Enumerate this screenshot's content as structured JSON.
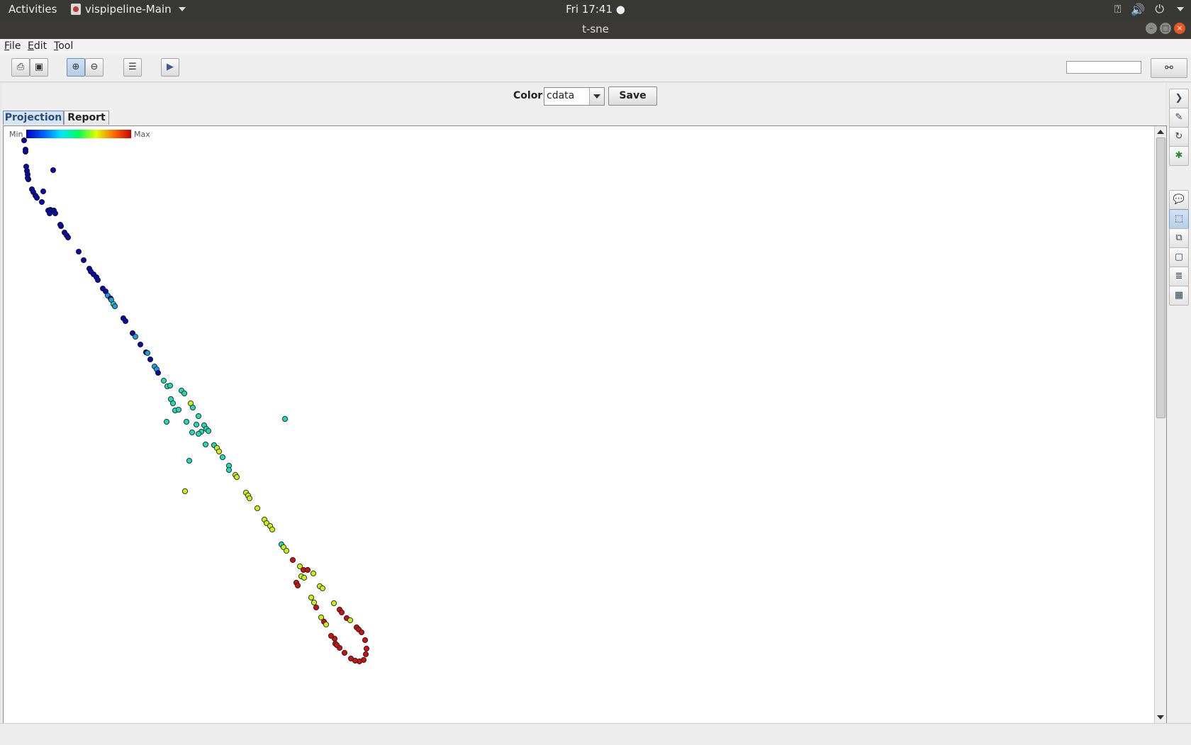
{
  "topbar": {
    "activities": "Activities",
    "app_menu": "vispipeline-Main",
    "clock": "Fri 17:41 ●",
    "tray_icons": [
      "network-icon",
      "volume-icon",
      "power-icon"
    ]
  },
  "window": {
    "title": "t-sne",
    "controls": [
      "minimize-icon",
      "maximize-icon",
      "close-icon"
    ]
  },
  "menubar": {
    "file": "File",
    "edit": "Edit",
    "tool": "Tool"
  },
  "toolbar": {
    "buttons": [
      "open-icon",
      "save-icon",
      "zoom-in-icon",
      "zoom-out-icon",
      "list-icon",
      "play-icon"
    ],
    "search_value": "",
    "find_button_icon": "binoculars-icon"
  },
  "projection": {
    "color_label": "Color",
    "color_value": "cdata",
    "save_label": "Save",
    "tabs": [
      "Projection",
      "Report"
    ],
    "selected_tab": "Projection",
    "legend_min": "Min",
    "legend_max": "Max",
    "colormap": [
      "#0000bb",
      "#0060ff",
      "#00e5ff",
      "#00ff55",
      "#dfff00",
      "#ff6a00",
      "#cc0000"
    ]
  },
  "sidebar": {
    "buttons": [
      "expand-icon",
      "edit-icon",
      "refresh-icon",
      "star-icon",
      "comment-icon",
      "select-icon",
      "copy-icon",
      "frame-icon",
      "list-icon",
      "table-icon"
    ]
  },
  "chart_data": {
    "type": "scatter",
    "title": "",
    "xlabel": "",
    "ylabel": "",
    "color_scale": "Min-Max jet colormap (cdata)",
    "x_range": [
      0,
      1640
    ],
    "y_range": [
      0,
      842
    ],
    "note_units": "coordinates are projection-space positions in plot pixels (no axes printed)",
    "points": [
      [
        33,
        197,
        0
      ],
      [
        35,
        210,
        0
      ],
      [
        35,
        213,
        0
      ],
      [
        36,
        234,
        0
      ],
      [
        37,
        240,
        0
      ],
      [
        38,
        245,
        0
      ],
      [
        39,
        252,
        0
      ],
      [
        38,
        250,
        0
      ],
      [
        74,
        239,
        0
      ],
      [
        44,
        266,
        0
      ],
      [
        46,
        270,
        0
      ],
      [
        49,
        275,
        0
      ],
      [
        51,
        278,
        0
      ],
      [
        60,
        269,
        0
      ],
      [
        58,
        284,
        0
      ],
      [
        67,
        296,
        0
      ],
      [
        70,
        295,
        0
      ],
      [
        75,
        296,
        0
      ],
      [
        77,
        300,
        0
      ],
      [
        69,
        300,
        0
      ],
      [
        85,
        318,
        0
      ],
      [
        84,
        316,
        0
      ],
      [
        90,
        327,
        0
      ],
      [
        93,
        331,
        0
      ],
      [
        95,
        334,
        0
      ],
      [
        110,
        354,
        0
      ],
      [
        117,
        366,
        0
      ],
      [
        125,
        378,
        0
      ],
      [
        127,
        382,
        0
      ],
      [
        131,
        386,
        0
      ],
      [
        135,
        390,
        0
      ],
      [
        137,
        394,
        0
      ],
      [
        144,
        406,
        0
      ],
      [
        148,
        410,
        0
      ],
      [
        151,
        416,
        1
      ],
      [
        155,
        420,
        0
      ],
      [
        156,
        422,
        1
      ],
      [
        159,
        428,
        2
      ],
      [
        161,
        431,
        1
      ],
      [
        173,
        448,
        0
      ],
      [
        176,
        452,
        0
      ],
      [
        186,
        469,
        0
      ],
      [
        190,
        474,
        1
      ],
      [
        197,
        485,
        0
      ],
      [
        205,
        496,
        0
      ],
      [
        207,
        497,
        1
      ],
      [
        211,
        506,
        0
      ],
      [
        217,
        516,
        1
      ],
      [
        220,
        520,
        1
      ],
      [
        222,
        525,
        0
      ],
      [
        230,
        536,
        2
      ],
      [
        235,
        544,
        2
      ],
      [
        239,
        543,
        2
      ],
      [
        255,
        550,
        2
      ],
      [
        259,
        554,
        2
      ],
      [
        240,
        562,
        2
      ],
      [
        243,
        568,
        2
      ],
      [
        268,
        568,
        3
      ],
      [
        271,
        574,
        2
      ],
      [
        246,
        578,
        2
      ],
      [
        251,
        577,
        2
      ],
      [
        279,
        586,
        2
      ],
      [
        234,
        594,
        2
      ],
      [
        262,
        594,
        2
      ],
      [
        276,
        598,
        2
      ],
      [
        287,
        599,
        2
      ],
      [
        290,
        604,
        2
      ],
      [
        283,
        608,
        2
      ],
      [
        270,
        609,
        2
      ],
      [
        293,
        607,
        2
      ],
      [
        279,
        611,
        2
      ],
      [
        401,
        590,
        2
      ],
      [
        289,
        626,
        2
      ],
      [
        301,
        627,
        2
      ],
      [
        305,
        631,
        3
      ],
      [
        308,
        636,
        3
      ],
      [
        313,
        644,
        2
      ],
      [
        266,
        649,
        2
      ],
      [
        322,
        656,
        2
      ],
      [
        322,
        662,
        2
      ],
      [
        331,
        669,
        3
      ],
      [
        333,
        672,
        3
      ],
      [
        260,
        692,
        3
      ],
      [
        346,
        694,
        3
      ],
      [
        349,
        698,
        3
      ],
      [
        351,
        702,
        3
      ],
      [
        362,
        716,
        3
      ],
      [
        372,
        732,
        3
      ],
      [
        375,
        737,
        3
      ],
      [
        380,
        741,
        3
      ],
      [
        383,
        746,
        3
      ],
      [
        396,
        767,
        2
      ],
      [
        399,
        771,
        3
      ],
      [
        403,
        776,
        3
      ],
      [
        412,
        789,
        4
      ],
      [
        422,
        798,
        3
      ],
      [
        427,
        803,
        4
      ],
      [
        433,
        803,
        4
      ],
      [
        441,
        808,
        3
      ],
      [
        424,
        812,
        3
      ],
      [
        428,
        814,
        3
      ],
      [
        417,
        821,
        4
      ],
      [
        419,
        825,
        4
      ],
      [
        450,
        826,
        3
      ],
      [
        454,
        829,
        3
      ],
      [
        438,
        842,
        3
      ],
      [
        442,
        849,
        3
      ],
      [
        445,
        856,
        4
      ],
      [
        452,
        870,
        3
      ],
      [
        456,
        876,
        4
      ],
      [
        459,
        880,
        3
      ],
      [
        470,
        850,
        3
      ],
      [
        478,
        859,
        4
      ],
      [
        481,
        863,
        4
      ],
      [
        488,
        871,
        4
      ],
      [
        493,
        874,
        3
      ],
      [
        502,
        884,
        4
      ],
      [
        505,
        887,
        4
      ],
      [
        509,
        891,
        4
      ],
      [
        514,
        902,
        4
      ],
      [
        516,
        914,
        4
      ],
      [
        515,
        922,
        4
      ],
      [
        512,
        930,
        4
      ],
      [
        506,
        932,
        4
      ],
      [
        500,
        931,
        4
      ],
      [
        494,
        928,
        4
      ],
      [
        485,
        920,
        4
      ],
      [
        478,
        913,
        4
      ],
      [
        472,
        907,
        4
      ],
      [
        471,
        900,
        4
      ],
      [
        466,
        896,
        4
      ],
      [
        474,
        909,
        4
      ]
    ]
  }
}
